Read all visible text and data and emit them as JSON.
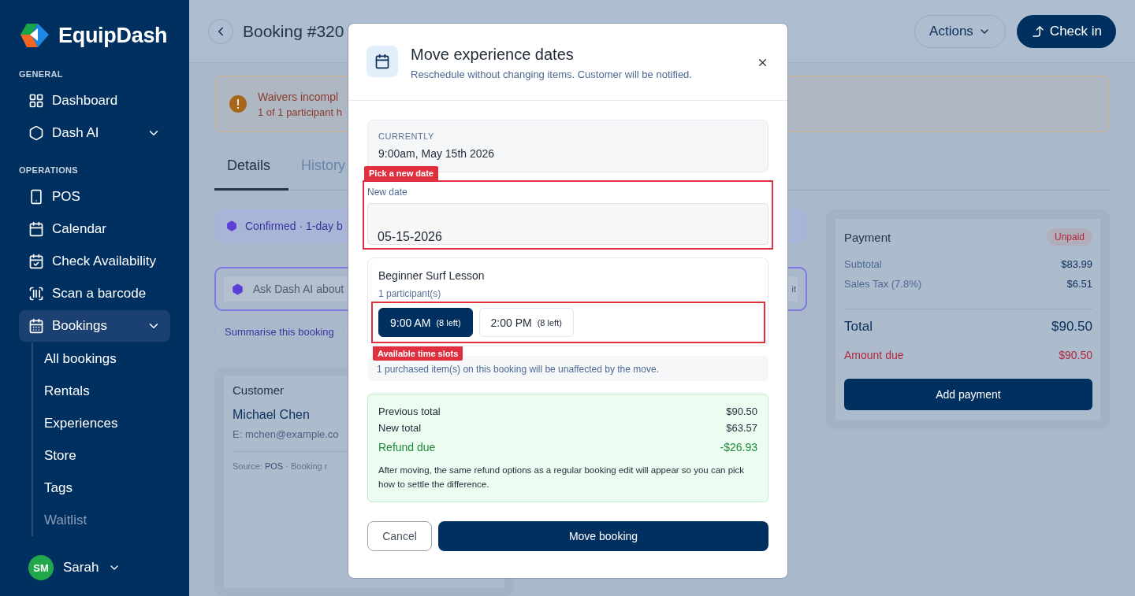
{
  "sidebar": {
    "brand": "EquipDash",
    "sections": [
      {
        "heading": "GENERAL",
        "items": [
          {
            "label": "Dashboard",
            "selected": false,
            "kind": "link"
          },
          {
            "label": "Dash AI",
            "selected": false,
            "kind": "group"
          }
        ]
      },
      {
        "heading": "OPERATIONS",
        "items": [
          {
            "label": "POS",
            "selected": false,
            "kind": "link"
          },
          {
            "label": "Calendar",
            "selected": false,
            "kind": "link"
          },
          {
            "label": "Check Availability",
            "selected": false,
            "kind": "link"
          },
          {
            "label": "Scan a barcode",
            "selected": false,
            "kind": "link"
          },
          {
            "label": "Bookings",
            "selected": true,
            "kind": "group",
            "children": [
              {
                "label": "All bookings",
                "disabled": false
              },
              {
                "label": "Rentals",
                "disabled": false
              },
              {
                "label": "Experiences",
                "disabled": false
              },
              {
                "label": "Store",
                "disabled": false
              },
              {
                "label": "Tags",
                "disabled": false
              },
              {
                "label": "Waitlist",
                "disabled": true
              }
            ]
          }
        ]
      }
    ],
    "user": {
      "initials": "SM",
      "name": "Sarah"
    }
  },
  "header": {
    "title": "Booking #320",
    "actions": "Actions",
    "check_in": "Check in"
  },
  "alert": {
    "title": "Waivers incompl",
    "text": "1 of 1 participant h"
  },
  "tabs": [
    {
      "label": "Details",
      "selected": true
    },
    {
      "label": "History",
      "selected": false
    }
  ],
  "status": "Confirmed · 1-day b",
  "ask_ai": {
    "placeholder": "Ask Dash AI about",
    "button": "it"
  },
  "suggestions": [
    "Summarise this booking"
  ],
  "customer": {
    "heading": "Customer",
    "name": "Michael Chen",
    "email": "E: mchen@example.co",
    "meta": "Source: **POS**  ·  Booking r"
  },
  "payment": {
    "title": "Payment",
    "badge": "Unpaid",
    "lines": [
      {
        "label": "Subtotal",
        "value": "$83.99"
      },
      {
        "label": "Sales Tax (7.8%)",
        "value": "$6.51"
      }
    ],
    "total": {
      "label": "Total",
      "value": "$90.50"
    },
    "due": {
      "label": "Amount due",
      "value": "$90.50"
    },
    "button": "Add payment"
  },
  "modal": {
    "title": "Move experience dates",
    "subtitle": "Reschedule without changing items. Customer will be notified.",
    "current": {
      "label": "CURRENTLY",
      "value": "9:00am, May 15th 2026"
    },
    "date_hint": "Pick a new date",
    "new_date": {
      "label": "New date",
      "value": "05-15-2026"
    },
    "experience": {
      "name": "Beginner Surf Lesson",
      "participants": "1 participant(s)",
      "slots": [
        {
          "time": "9:00 AM",
          "left": "(8 left)",
          "selected": true
        },
        {
          "time": "2:00 PM",
          "left": "(8 left)",
          "selected": false
        }
      ]
    },
    "slots_hint": "Available time slots",
    "note": "1 purchased item(s) on this booking will be unaffected by the move.",
    "summary": {
      "rows": [
        {
          "label": "Previous total",
          "value": "$90.50",
          "kind": "plain"
        },
        {
          "label": "New total",
          "value": "$63.57",
          "kind": "plain"
        },
        {
          "label": "Refund due",
          "value": "-$26.93",
          "kind": "refund"
        }
      ],
      "note": "After moving, the same refund options as a regular booking edit will appear so you can pick how to settle the difference."
    },
    "cancel": "Cancel",
    "confirm": "Move booking"
  }
}
